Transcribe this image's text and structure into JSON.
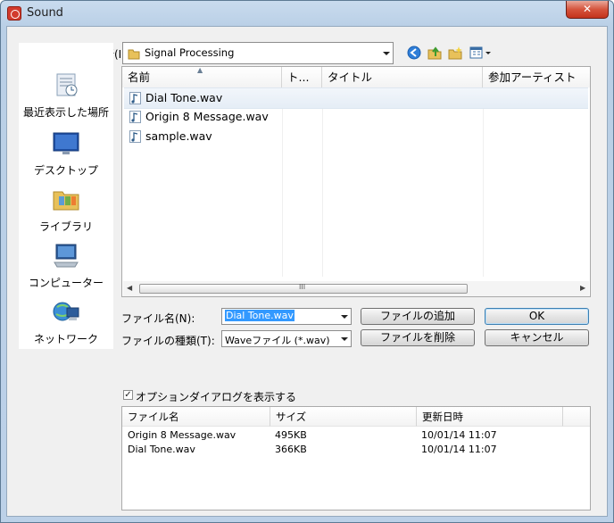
{
  "window": {
    "title": "Sound",
    "close_glyph": "✕"
  },
  "look_in": {
    "label": "ファイルの場所(I):",
    "value": "Signal Processing"
  },
  "toolbar": {
    "icons": [
      "back-icon",
      "up-folder-icon",
      "new-folder-icon",
      "view-menu-icon"
    ]
  },
  "places": [
    {
      "label": "最近表示した場所",
      "icon": "recent-places-icon"
    },
    {
      "label": "デスクトップ",
      "icon": "desktop-icon"
    },
    {
      "label": "ライブラリ",
      "icon": "libraries-icon"
    },
    {
      "label": "コンピューター",
      "icon": "computer-icon"
    },
    {
      "label": "ネットワーク",
      "icon": "network-icon"
    }
  ],
  "file_list": {
    "columns": [
      "名前",
      "ト...",
      "タイトル",
      "参加アーティスト"
    ],
    "files": [
      "Dial Tone.wav",
      "Origin 8 Message.wav",
      "sample.wav"
    ],
    "scroll_grip": "III"
  },
  "filename": {
    "label": "ファイル名(N):",
    "value": "Dial Tone.wav"
  },
  "filetype": {
    "label": "ファイルの種類(T):",
    "value": "Waveファイル (*.wav)"
  },
  "buttons": {
    "add": "ファイルの追加",
    "ok": "OK",
    "delete": "ファイルを削除",
    "cancel": "キャンセル"
  },
  "options_checkbox": {
    "label": "オプションダイアログを表示する",
    "checked": true,
    "mark": "✓"
  },
  "options_list": {
    "columns": [
      "ファイル名",
      "サイズ",
      "更新日時"
    ],
    "rows": [
      {
        "name": "Origin 8 Message.wav",
        "size": "495KB",
        "date": "10/01/14 11:07"
      },
      {
        "name": "Dial Tone.wav",
        "size": "366KB",
        "date": "10/01/14 11:07"
      }
    ]
  },
  "colors": {
    "selection": "#3399ff",
    "titlebar": "#bcd1e8",
    "close": "#c4331c"
  }
}
